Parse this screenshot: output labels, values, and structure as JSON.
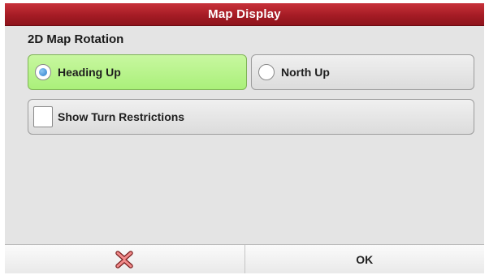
{
  "dialog": {
    "title": "Map Display"
  },
  "rotation": {
    "label": "2D Map Rotation",
    "options": [
      {
        "label": "Heading Up",
        "selected": true
      },
      {
        "label": "North Up",
        "selected": false
      }
    ]
  },
  "turn_restrictions": {
    "label": "Show Turn Restrictions",
    "checked": false
  },
  "footer": {
    "cancel_icon": "close-x-icon",
    "ok_label": "OK"
  },
  "colors": {
    "title_bar": "#a51c25",
    "selected_option": "#aaf07a",
    "radio_dot": "#2a7ecb",
    "cancel_icon": "#d24a4a"
  }
}
